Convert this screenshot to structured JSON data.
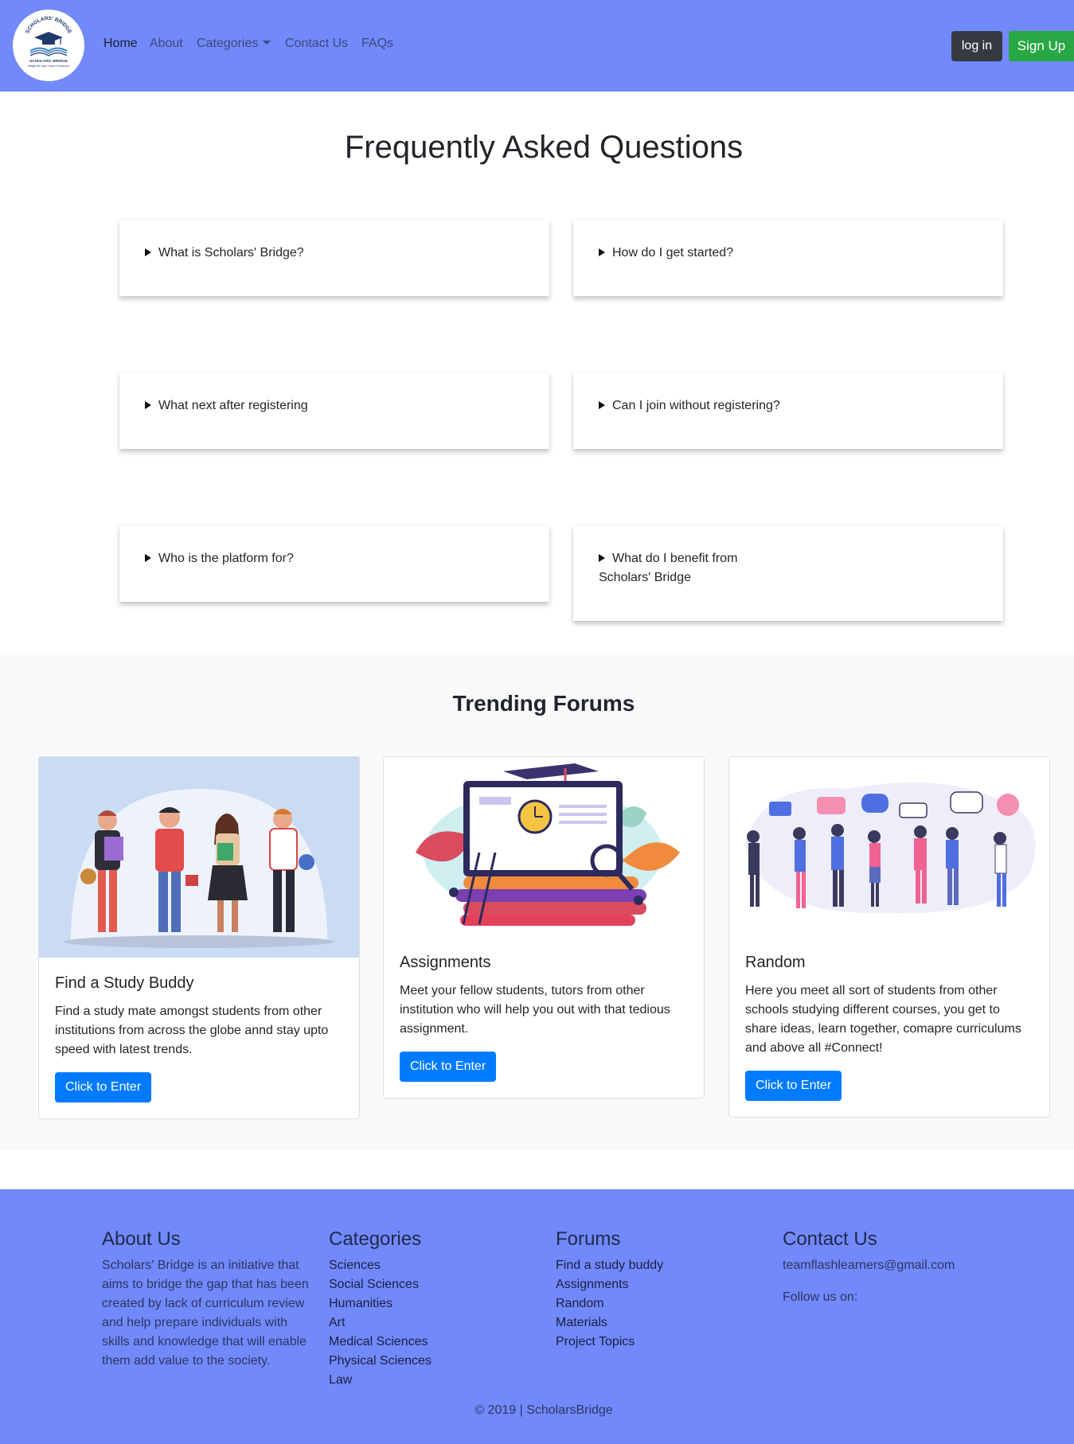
{
  "nav": {
    "logo_top_text": "SCHOLARS' BRIDGE",
    "logo_bottom_text": "SCHOLARS' BRIDGE",
    "logo_tagline": "Bridge the Gap in your Curriculum",
    "links": [
      "Home",
      "About",
      "Categories",
      "Contact Us",
      "FAQs"
    ],
    "login_label": "log in",
    "signup_label": "Sign Up"
  },
  "faq": {
    "title": "Frequently Asked Questions",
    "items": [
      "What is Scholars' Bridge?",
      "How do I get started?",
      "What next after registering",
      "Can I join without registering?",
      "Who is the platform for?",
      "What do I benefit from Scholars' Bridge"
    ]
  },
  "trending": {
    "title": "Trending Forums",
    "cards": [
      {
        "title": "Find a Study Buddy",
        "description": "Find a study mate amongst students from other institutions from across the globe annd stay upto speed with latest trends.",
        "button": "Click to Enter"
      },
      {
        "title": "Assignments",
        "description": "Meet your fellow students, tutors from other institution who will help you out with that tedious assignment.",
        "button": "Click to Enter"
      },
      {
        "title": "Random",
        "description": "Here you meet all sort of students from other schools studying different courses, you get to share ideas, learn together, comapre curriculums and above all #Connect!",
        "button": "Click to Enter"
      }
    ]
  },
  "footer": {
    "about": {
      "heading": "About Us",
      "text": "Scholars' Bridge is an initiative that aims to bridge the gap that has been created by lack of curriculum review and help prepare individuals with skills and knowledge that will enable them add value to the society."
    },
    "categories": {
      "heading": "Categories",
      "items": [
        "Sciences",
        "Social Sciences",
        "Humanities",
        "Art",
        "Medical Sciences",
        "Physical Sciences",
        "Law"
      ]
    },
    "forums": {
      "heading": "Forums",
      "items": [
        "Find a study buddy",
        "Assignments",
        "Random",
        "Materials",
        "Project Topics"
      ]
    },
    "contact": {
      "heading": "Contact Us",
      "email": "teamflashlearners@gmail.com",
      "follow": "Follow us on:"
    },
    "copyright": "© 2019 | ScholarsBridge"
  },
  "colors": {
    "navbar": "#7189fa",
    "login": "#343a40",
    "signup": "#28a745",
    "primary_button": "#007bff",
    "section_bg": "#f8f9fa"
  }
}
